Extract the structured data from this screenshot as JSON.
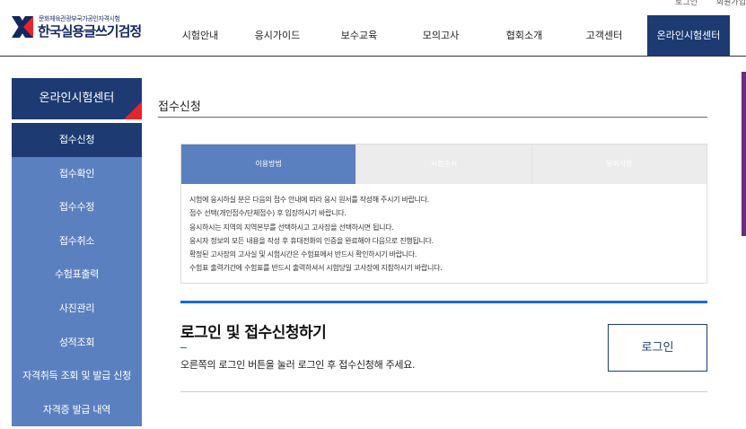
{
  "header": {
    "util_links": [
      "로그인",
      "회원가입"
    ],
    "logo_sub": "문화체육관광부국가공인자격시험",
    "logo_main": "한국실용글쓰기검정",
    "nav": [
      "시험안내",
      "응시가이드",
      "보수교육",
      "모의고사",
      "협회소개",
      "고객센터",
      "온라인시험센터"
    ],
    "active_nav": "온라인시험센터"
  },
  "sidebar": {
    "title": "온라인시험센터",
    "items": [
      "접수신청",
      "접수확인",
      "접수수정",
      "접수취소",
      "수험표출력",
      "사진관리",
      "성적조회",
      "자격취득 조회 및 발급 신청",
      "자격증 발급 내역"
    ],
    "active": "접수신청"
  },
  "main": {
    "page_title": "접수신청",
    "tabs": [
      "이용방법",
      "시험순서",
      "유의사항"
    ],
    "active_tab": "이용방법",
    "instructions": [
      "시험에 응시하실 분은 다음의 접수 안내에 따라 응시 원서를 작성해 주시기 바랍니다.",
      "접수 선택(개인접수/단체접수) 후 입장하시기 바랍니다.",
      "응시하시는 지역의 지역본부를 선택하시고 고사장을 선택하시면 됩니다.",
      "응시자 정보의 모든 내용을 작성 후 휴대전화의 인증을 완료해야 다음으로 진행됩니다.",
      "확정된 고사장의 고사실 및 시험시간은 수험표에서 반드시 확인하시기 바랍니다.",
      "수험표 출력기간에 수험표를 반드시 출력하셔서 시험당일 고사장에 지참하시기 바랍니다."
    ],
    "login": {
      "heading": "로그인 및 접수신청하기",
      "description": "오른쪽의 로그인 버튼을 눌러 로그인 후 접수신청해 주세요.",
      "button": "로그인"
    }
  },
  "colors": {
    "navy": "#1d3b72",
    "menu_blue": "#5b80c0",
    "accent_red": "#e8232a",
    "accent_blue": "#1d6ad2"
  }
}
